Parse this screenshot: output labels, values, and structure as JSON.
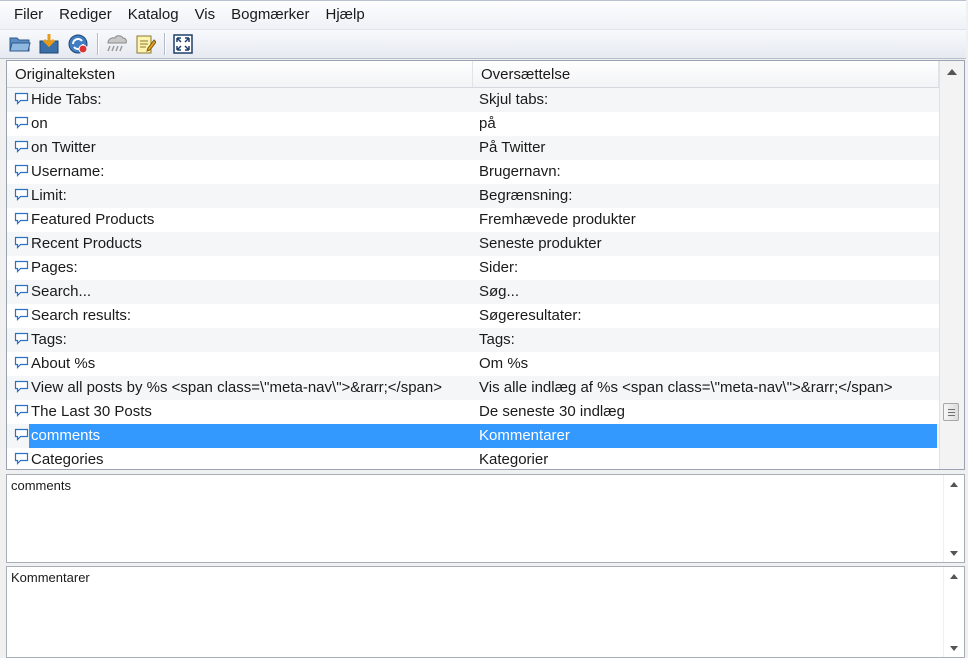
{
  "menubar": {
    "items": [
      "Filer",
      "Rediger",
      "Katalog",
      "Vis",
      "Bogmærker",
      "Hjælp"
    ]
  },
  "toolbar": {
    "buttons": [
      "open-folder-icon",
      "save-icon",
      "update-icon",
      "validate-icon",
      "edit-comment-icon",
      "fullscreen-icon"
    ]
  },
  "list": {
    "headers": {
      "original": "Originalteksten",
      "translation": "Oversættelse"
    },
    "rows": [
      {
        "original": "Hide Tabs:",
        "translation": "Skjul tabs:"
      },
      {
        "original": "on",
        "translation": "på"
      },
      {
        "original": "on Twitter",
        "translation": "På Twitter"
      },
      {
        "original": "Username:",
        "translation": "Brugernavn:"
      },
      {
        "original": "Limit:",
        "translation": "Begrænsning:"
      },
      {
        "original": "Featured Products",
        "translation": "Fremhævede produkter"
      },
      {
        "original": "Recent Products",
        "translation": "Seneste produkter"
      },
      {
        "original": "Pages:",
        "translation": "Sider:"
      },
      {
        "original": "Search...",
        "translation": "Søg..."
      },
      {
        "original": "Search results:",
        "translation": "Søgeresultater:"
      },
      {
        "original": "Tags:",
        "translation": "Tags:"
      },
      {
        "original": "About %s",
        "translation": "Om %s"
      },
      {
        "original": "View all posts by %s <span class=\\\"meta-nav\\\">&rarr;</span>",
        "translation": "Vis alle indlæg af %s <span class=\\\"meta-nav\\\">&rarr;</span>"
      },
      {
        "original": "The Last 30 Posts",
        "translation": "De seneste 30 indlæg"
      },
      {
        "original": "comments",
        "translation": "Kommentarer"
      },
      {
        "original": "Categories",
        "translation": "Kategorier"
      }
    ],
    "selected_index": 14
  },
  "source_pane": {
    "text": "comments"
  },
  "translation_pane": {
    "text": "Kommentarer"
  },
  "colors": {
    "selection": "#3399ff",
    "comment_icon": "#2a73c4"
  }
}
